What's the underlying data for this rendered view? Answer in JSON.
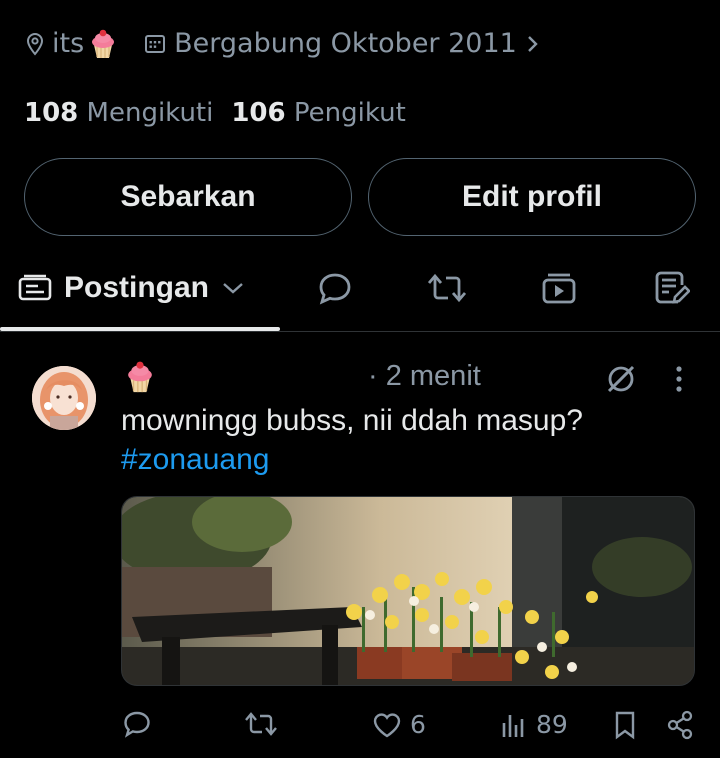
{
  "profile": {
    "location": "its",
    "joined": "Bergabung Oktober 2011",
    "following_count": "108",
    "following_label": "Mengikuti",
    "followers_count": "106",
    "followers_label": "Pengikut"
  },
  "buttons": {
    "share": "Sebarkan",
    "edit": "Edit profil"
  },
  "tabs": {
    "posts_label": "Postingan"
  },
  "post": {
    "time": "· 2 menit",
    "text": "mowningg bubss, nii ddah masup?",
    "hashtag": "#zonauang",
    "likes": "6",
    "views": "89"
  },
  "colors": {
    "background": "#000000",
    "text": "#e7e9ea",
    "muted": "#8b98a5",
    "link": "#1d9bf0",
    "border": "#2f3336"
  },
  "icons": [
    "location-icon",
    "calendar-icon",
    "cupcake-icon",
    "chevron-right-icon",
    "posts-tab-icon",
    "chevron-down-icon",
    "replies-icon",
    "reposts-icon",
    "media-icon",
    "articles-icon",
    "grok-icon",
    "more-icon",
    "reply-icon",
    "repost-icon",
    "heart-icon",
    "views-icon",
    "bookmark-icon",
    "share-icon"
  ]
}
